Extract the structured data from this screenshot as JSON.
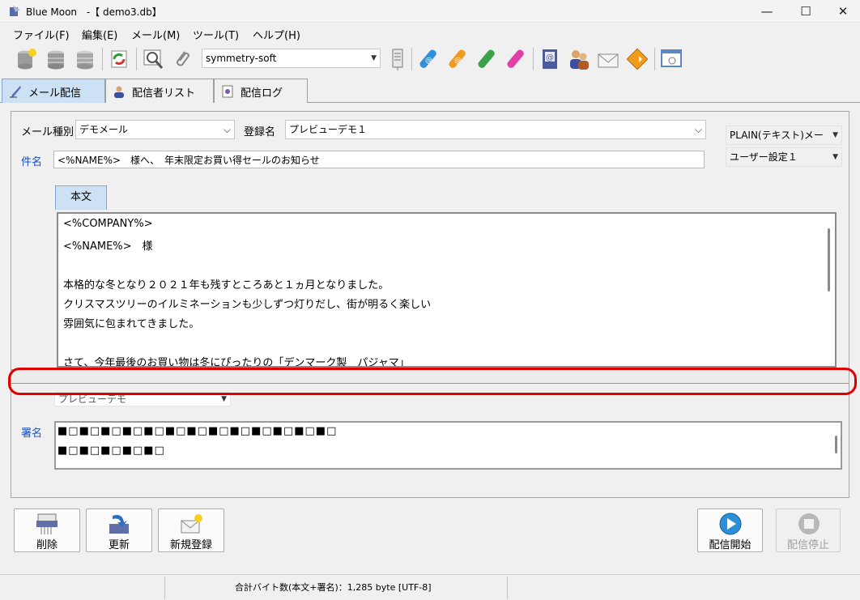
{
  "window": {
    "app_name": "Blue Moon",
    "file": " -【 demo3.db】",
    "minimize": "—",
    "maximize": "☐",
    "close": "✕"
  },
  "menu": [
    "ファイル(F)",
    "編集(E)",
    "メール(M)",
    "ツール(T)",
    "ヘルプ(H)"
  ],
  "toolbar": {
    "account_select": "symmetry-soft"
  },
  "tabs": [
    {
      "label": "メール配信",
      "icon": "quill-icon"
    },
    {
      "label": "配信者リスト",
      "icon": "address-book-icon"
    },
    {
      "label": "配信ログ",
      "icon": "log-icon"
    }
  ],
  "form": {
    "mail_type_label": "メール種別",
    "mail_type_value": "デモメール",
    "registered_name_label": "登録名",
    "registered_name_value": "プレビューデモ１",
    "format_value": "PLAIN(テキスト)メー",
    "user_setting_value": "ユーザー設定１",
    "subject_label": "件名",
    "subject_value": "<%NAME%>　様へ、　年末限定お買い得セールのお知らせ",
    "body_tab": "本文",
    "body_lines": [
      "<%COMPANY%>",
      "<%NAME%>　様",
      "",
      "本格的な冬となり２０２１年も残すところあと１ヵ月となりました。",
      "クリスマスツリーのイルミネーションも少しずつ灯りだし、街が明るく楽しい",
      "雰囲気に包まれてきました。",
      "",
      "さて、今年最後のお買い物は冬にぴったりの「デンマーク製　パジャマ」"
    ],
    "signature_select": "プレビューデモ",
    "signature_label": "署名",
    "signature_lines": [
      "■□■□■□■□■□■□■□■□■□■□■□■□■□",
      "■□■□■□■□■□"
    ]
  },
  "buttons": {
    "delete": "削除",
    "update": "更新",
    "new_register": "新規登録",
    "start_delivery": "配信開始",
    "stop_delivery": "配信停止"
  },
  "status": {
    "byte_count": "合計バイト数(本文+署名)：1,285 byte [UTF-8]"
  }
}
